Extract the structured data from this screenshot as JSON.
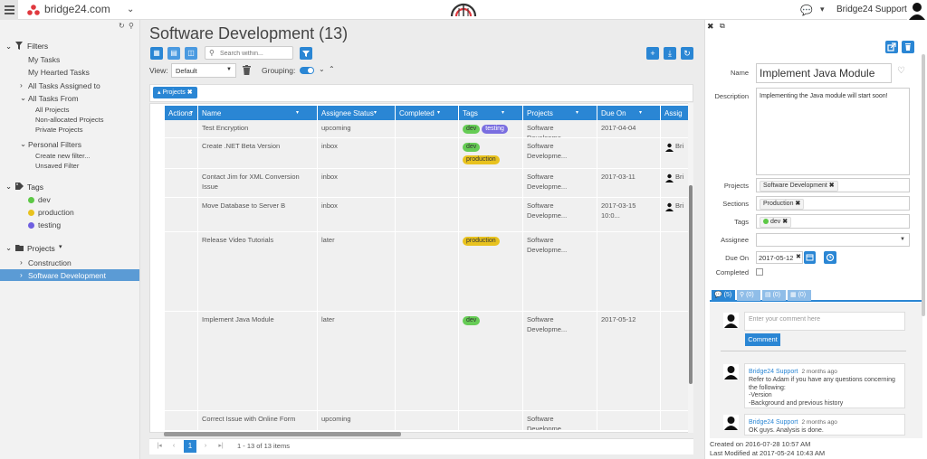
{
  "header": {
    "brand": "bridge24.com",
    "user_name": "Bridge24 Support",
    "colors": {
      "accent": "#2a86d4",
      "brand_red": "#e0383e"
    }
  },
  "sidebar": {
    "filters_title": "Filters",
    "my_tasks": "My Tasks",
    "my_hearted_tasks": "My Hearted Tasks",
    "all_tasks_assigned_to": "All Tasks Assigned to",
    "all_tasks_from": "All Tasks From",
    "all_projects": "All Projects",
    "non_allocated_projects": "Non-allocated Projects",
    "private_projects": "Private Projects",
    "personal_filters": "Personal Filters",
    "create_new_filter": "Create new filter...",
    "unsaved_filter": "Unsaved Filter",
    "tags_title": "Tags",
    "tags": [
      {
        "name": "dev",
        "color": "#5cc845"
      },
      {
        "name": "production",
        "color": "#e8c21e"
      },
      {
        "name": "testing",
        "color": "#6f5fe0"
      }
    ],
    "projects_title": "Projects",
    "projects": [
      "Construction",
      "Software Development"
    ]
  },
  "main": {
    "title": "Software Development (13)",
    "search_placeholder": "Search within...",
    "view_label": "View:",
    "view_value": "Default",
    "grouping_label": "Grouping:",
    "filter_chip": "Projects",
    "columns": [
      "Actions",
      "Name",
      "Assignee Status",
      "Completed",
      "Tags",
      "Projects",
      "Due On",
      "Assig"
    ],
    "rows": [
      {
        "name": "Test Encryption",
        "status": "upcoming",
        "tags": [
          "dev",
          "testing"
        ],
        "project": "Software Developme...",
        "due": "2017-04-04",
        "assignee": ""
      },
      {
        "name": "Create .NET Beta Version",
        "status": "inbox",
        "tags": [
          "dev",
          "production"
        ],
        "project": "Software Developme...",
        "due": "",
        "assignee": "Bri"
      },
      {
        "name": "Contact Jim for XML Conversion Issue",
        "status": "inbox",
        "tags": [],
        "project": "Software Developme...",
        "due": "2017-03-11",
        "assignee": "Bri"
      },
      {
        "name": "Move Database to Server B",
        "status": "inbox",
        "tags": [],
        "project": "Software Developme...",
        "due": "2017-03-15 10:0...",
        "assignee": "Bri"
      },
      {
        "name": "Release Video Tutorials",
        "status": "later",
        "tags": [
          "production"
        ],
        "project": "Software Developme...",
        "due": "",
        "assignee": ""
      },
      {
        "name": "Implement Java Module",
        "status": "later",
        "tags": [
          "dev"
        ],
        "project": "Software Developme...",
        "due": "2017-05-12",
        "assignee": ""
      },
      {
        "name": "Correct Issue with Online Form",
        "status": "upcoming",
        "tags": [],
        "project": "Software Developme...",
        "due": "",
        "assignee": ""
      }
    ],
    "pager": {
      "current": "1",
      "info": "1 - 13 of 13 items"
    }
  },
  "detail": {
    "name_label": "Name",
    "name_value": "Implement Java Module",
    "description_label": "Description",
    "description_value": "Implementing the Java module will start soon!",
    "projects_label": "Projects",
    "projects_value": "Software Development",
    "sections_label": "Sections",
    "sections_value": "Production",
    "tags_label": "Tags",
    "tags_value": "dev",
    "assignee_label": "Assignee",
    "due_on_label": "Due On",
    "due_on_value": "2017-05-12",
    "completed_label": "Completed",
    "tabs": [
      "(5)",
      "(0)",
      "(0)",
      "(0)"
    ],
    "comment_placeholder": "Enter your comment here",
    "comment_button": "Comment",
    "comments": [
      {
        "author": "Bridge24 Support",
        "time": "2 months ago",
        "lines": [
          "Refer to Adam if you have any questions concerning",
          "the following:",
          "-Version",
          "-Background and previous history"
        ]
      },
      {
        "author": "Bridge24 Support",
        "time": "2 months ago",
        "lines": [
          "OK guys. Analysis is done."
        ]
      }
    ],
    "created_on": "Created on 2016-07-28 10:57 AM",
    "last_modified_on": "Last Modified at 2017-05-24 10:43 AM"
  }
}
